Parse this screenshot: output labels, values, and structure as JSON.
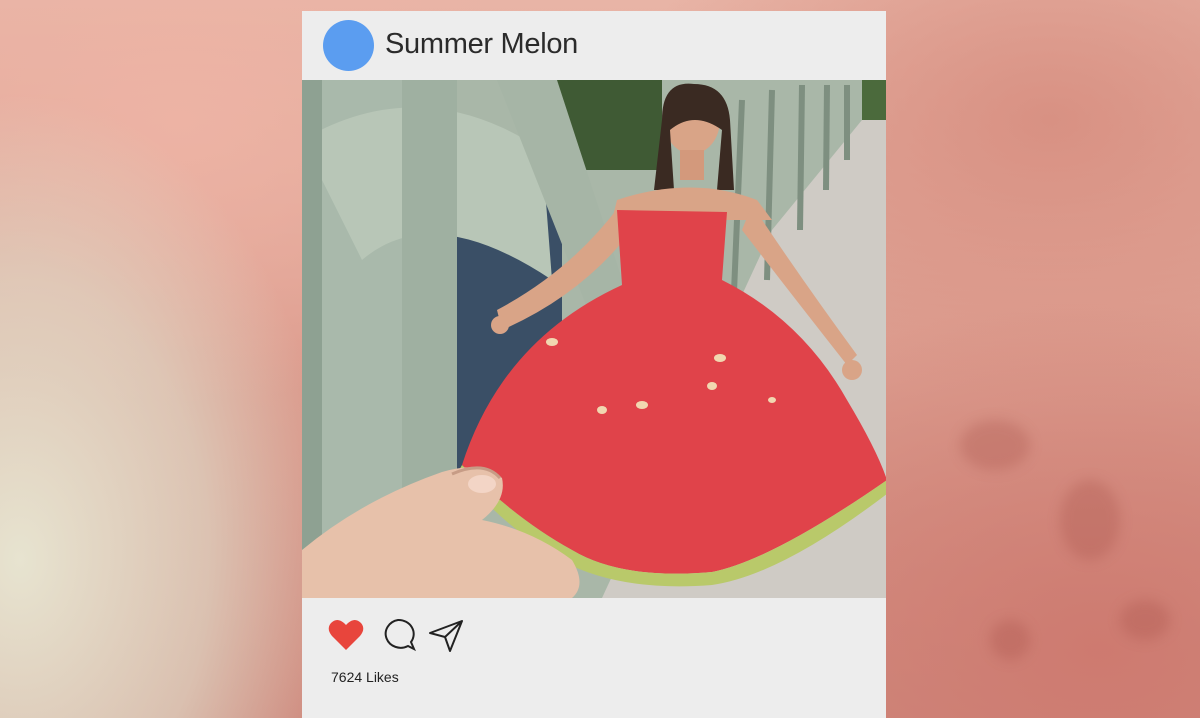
{
  "post": {
    "username": "Summer Melon",
    "likes_text": "7624 Likes"
  },
  "icons": {
    "avatar": "avatar-circle",
    "like": "heart-icon",
    "comment": "comment-bubble-icon",
    "share": "paper-plane-icon"
  },
  "colors": {
    "avatar": "#5b9df0",
    "heart": "#e8453c",
    "card": "#ededed"
  }
}
